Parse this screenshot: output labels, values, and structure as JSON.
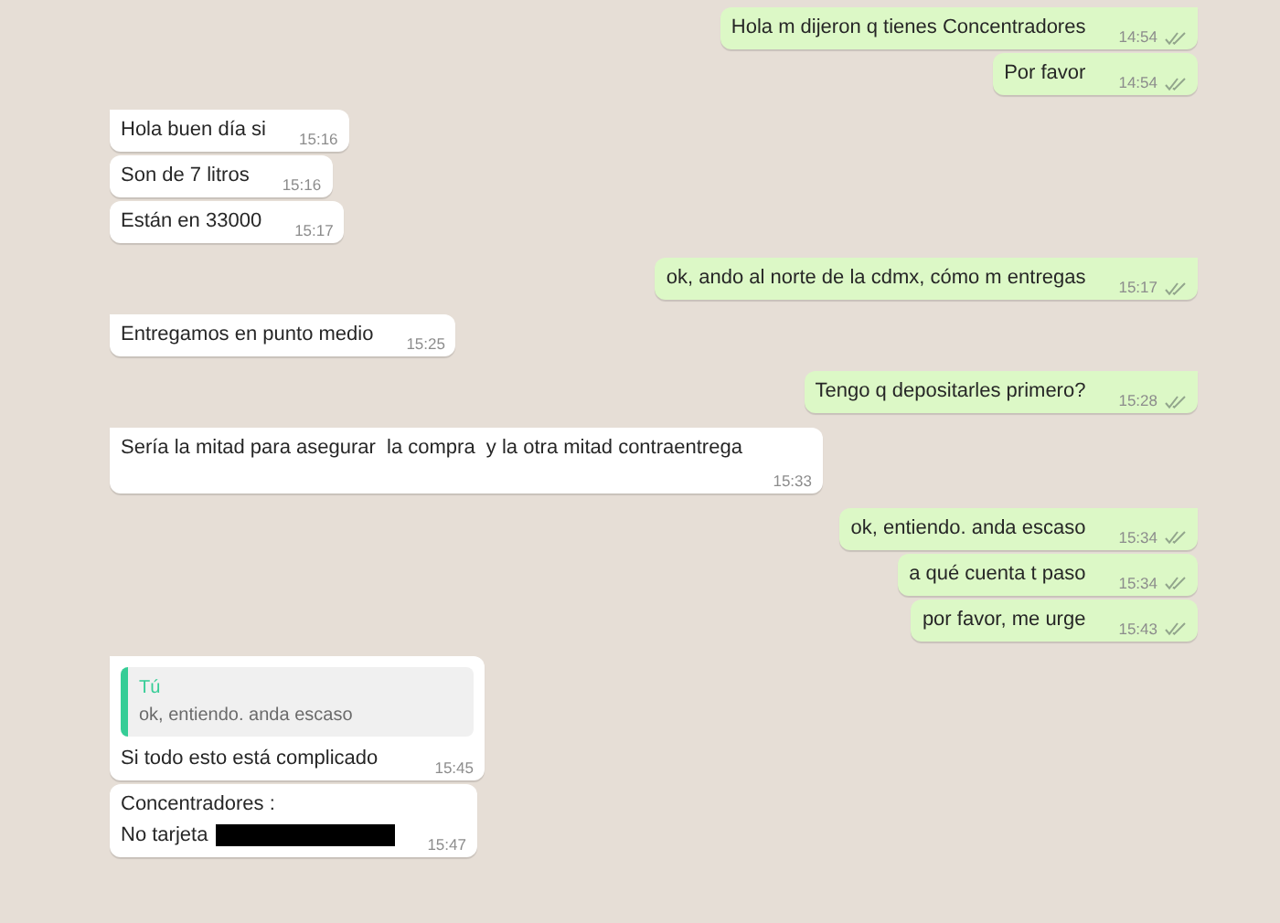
{
  "messages": [
    {
      "outgoing": true,
      "first_in_group": true,
      "lines": [
        "Hola m dijeron q tienes Concentradores"
      ],
      "time": "14:54",
      "delivered": true
    },
    {
      "outgoing": true,
      "first_in_group": false,
      "lines": [
        "Por favor"
      ],
      "time": "14:54",
      "delivered": true
    },
    {
      "outgoing": false,
      "first_in_group": true,
      "lines": [
        "Hola buen día si"
      ],
      "time": "15:16"
    },
    {
      "outgoing": false,
      "first_in_group": false,
      "lines": [
        "Son de 7 litros"
      ],
      "time": "15:16"
    },
    {
      "outgoing": false,
      "first_in_group": false,
      "lines": [
        "Están en 33000"
      ],
      "time": "15:17"
    },
    {
      "outgoing": true,
      "first_in_group": true,
      "lines": [
        "ok, ando al norte de la cdmx, cómo m entregas"
      ],
      "time": "15:17",
      "delivered": true
    },
    {
      "outgoing": false,
      "first_in_group": true,
      "lines": [
        "Entregamos en punto medio"
      ],
      "time": "15:25"
    },
    {
      "outgoing": true,
      "first_in_group": true,
      "lines": [
        "Tengo q depositarles primero?"
      ],
      "time": "15:28",
      "delivered": true
    },
    {
      "outgoing": false,
      "first_in_group": true,
      "lines": [
        "Sería la mitad para asegurar  la compra  y la otra mitad contraentrega"
      ],
      "time": "15:33"
    },
    {
      "outgoing": true,
      "first_in_group": true,
      "lines": [
        "ok, entiendo. anda escaso"
      ],
      "time": "15:34",
      "delivered": true
    },
    {
      "outgoing": true,
      "first_in_group": false,
      "lines": [
        "a qué cuenta t paso"
      ],
      "time": "15:34",
      "delivered": true
    },
    {
      "outgoing": true,
      "first_in_group": false,
      "lines": [
        "por favor, me urge"
      ],
      "time": "15:43",
      "delivered": true
    },
    {
      "outgoing": false,
      "first_in_group": true,
      "quote": {
        "author": "Tú",
        "text": "ok, entiendo. anda escaso"
      },
      "lines": [
        "Si todo esto está complicado"
      ],
      "time": "15:45"
    },
    {
      "outgoing": false,
      "first_in_group": false,
      "lines": [
        "Concentradores :",
        "No tarjeta"
      ],
      "redacted": true,
      "time": "15:47"
    }
  ]
}
